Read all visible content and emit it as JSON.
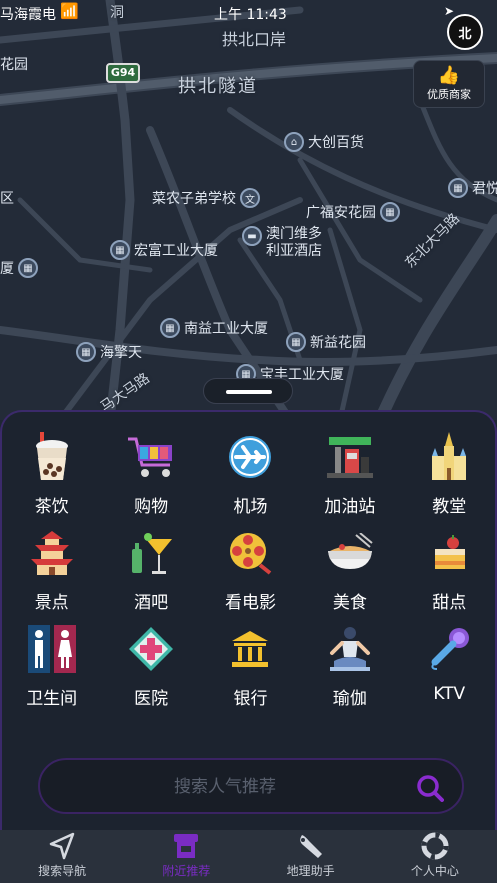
{
  "status": {
    "left": "马海霞电",
    "time": "上午 11:43"
  },
  "compass_label": "北",
  "quality_button": "优质商家",
  "road_badge": "G94",
  "map_labels": [
    "拱北口岸",
    "拱北隧道",
    "东北大马路",
    "马大马路",
    "洞"
  ],
  "pois": [
    "大创百货",
    "菜农子弟学校",
    "广福安花园",
    "宏富工业大厦",
    "澳门维多利亚酒店",
    "南益工业大厦",
    "海擎天",
    "新益花园",
    "宝丰工业大厦",
    "君悦",
    "花园",
    "区",
    "厦"
  ],
  "categories": [
    {
      "label": "茶饮",
      "icon": "bubble-tea-icon"
    },
    {
      "label": "购物",
      "icon": "shopping-cart-icon"
    },
    {
      "label": "机场",
      "icon": "airplane-icon"
    },
    {
      "label": "加油站",
      "icon": "gas-station-icon"
    },
    {
      "label": "教堂",
      "icon": "church-icon"
    },
    {
      "label": "景点",
      "icon": "pagoda-icon"
    },
    {
      "label": "酒吧",
      "icon": "cocktail-icon"
    },
    {
      "label": "看电影",
      "icon": "film-reel-icon"
    },
    {
      "label": "美食",
      "icon": "noodle-bowl-icon"
    },
    {
      "label": "甜点",
      "icon": "cake-icon"
    },
    {
      "label": "卫生间",
      "icon": "restroom-icon"
    },
    {
      "label": "医院",
      "icon": "hospital-cross-icon"
    },
    {
      "label": "银行",
      "icon": "bank-icon"
    },
    {
      "label": "瑜伽",
      "icon": "yoga-icon"
    },
    {
      "label": "KTV",
      "icon": "microphone-icon"
    }
  ],
  "search": {
    "placeholder": "搜索人气推荐"
  },
  "tabs": [
    {
      "label": "搜索导航",
      "icon": "navigation-arrow-icon"
    },
    {
      "label": "附近推荐",
      "icon": "shop-icon"
    },
    {
      "label": "地理助手",
      "icon": "wrench-icon"
    },
    {
      "label": "个人中心",
      "icon": "lifebuoy-icon"
    }
  ],
  "colors": {
    "accent": "#7a2cc4",
    "map_bg": "#232b38",
    "panel_bg": "#1c232f"
  }
}
